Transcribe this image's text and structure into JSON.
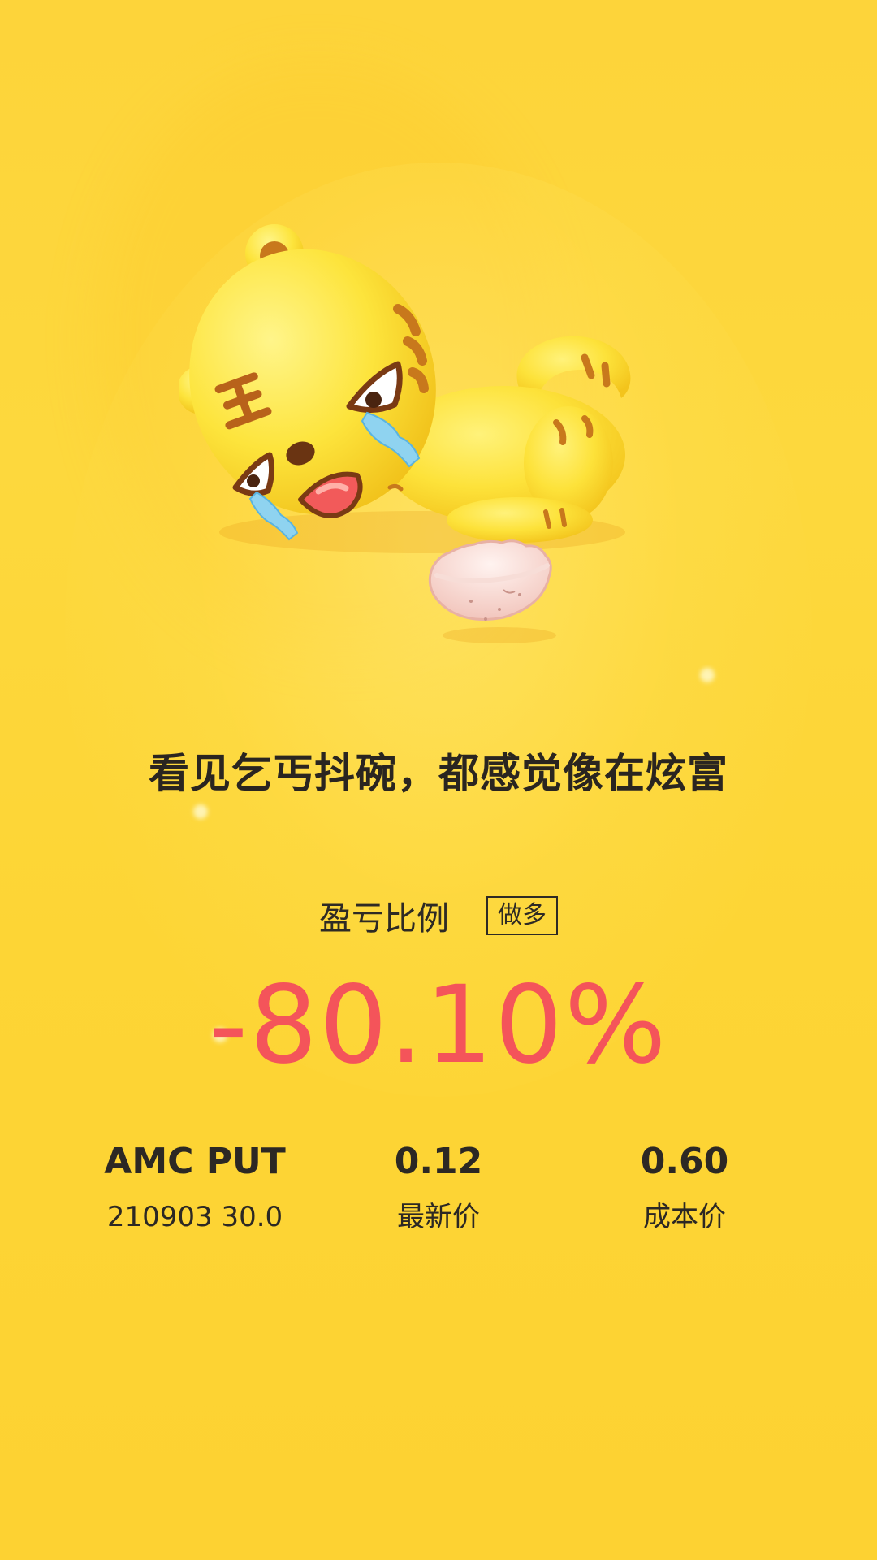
{
  "headline": "看见乞丐抖碗，都感觉像在炫富",
  "pnl": {
    "label": "盈亏比例",
    "direction_tag": "做多",
    "value": "-80.10%",
    "color": "#f4545a"
  },
  "position": {
    "symbol": "AMC PUT",
    "contract": "210903 30.0"
  },
  "latest_price": {
    "value": "0.12",
    "label": "最新价"
  },
  "cost_price": {
    "value": "0.60",
    "label": "成本价"
  },
  "illustration": {
    "subject": "crying-tiger-mascot-icon",
    "prop": "broken-eggshell-icon",
    "mark": "王"
  },
  "colors": {
    "background": "#fdd43a",
    "text": "#2c2824",
    "loss": "#f4545a"
  }
}
